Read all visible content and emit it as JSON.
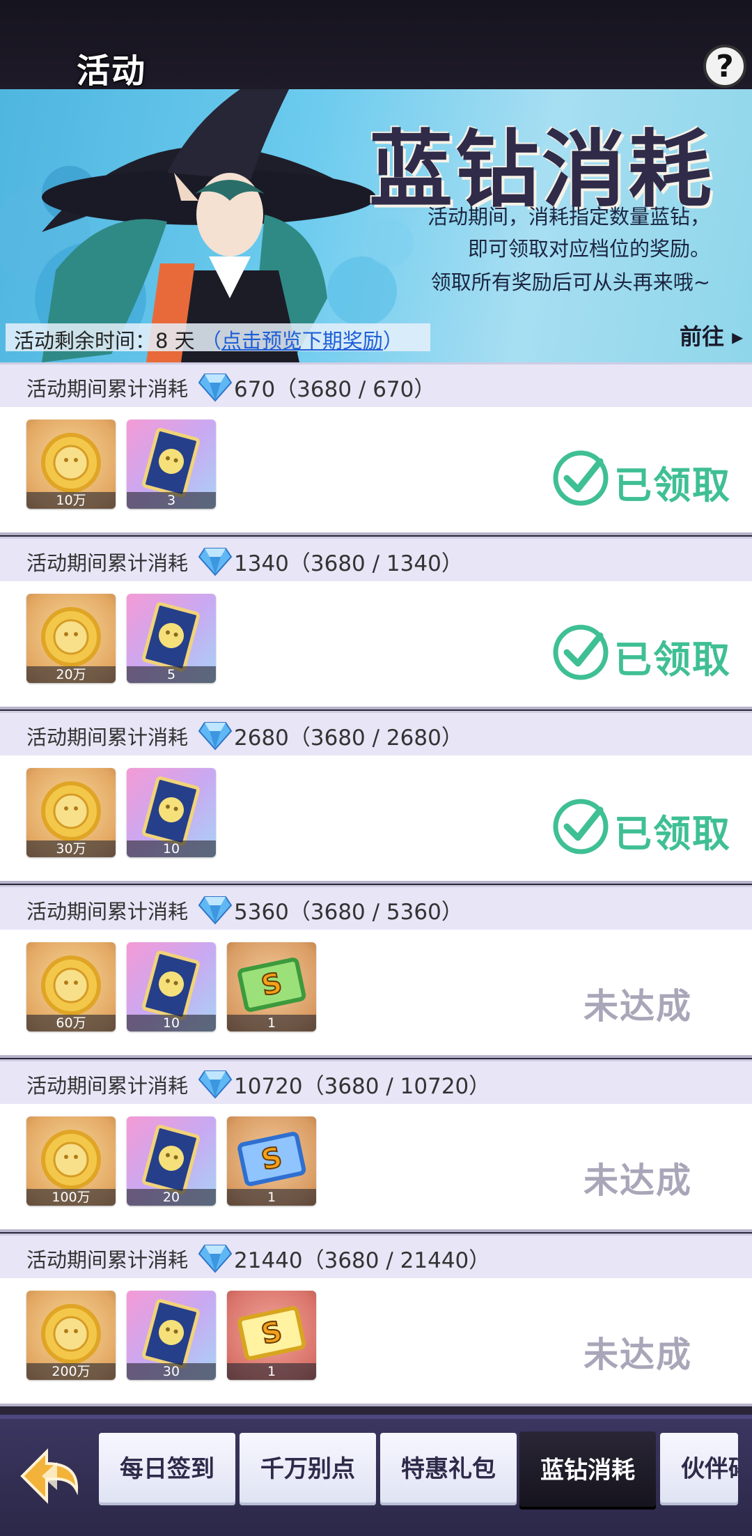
{
  "header": {
    "title": "活动",
    "help_icon": "question-mark-icon"
  },
  "banner": {
    "title": "蓝钻消耗",
    "desc_lines": [
      "活动期间，消耗指定数量蓝钻，",
      "即可领取对应档位的奖励。",
      "领取所有奖励后可从头再来哦~"
    ],
    "timer_label": "活动剩余时间：8 天",
    "timer_paren_open": "（",
    "preview_link": "点击预览下期奖励",
    "timer_paren_close": "）",
    "goto_label": "前往 ▸"
  },
  "tiers": [
    {
      "label": "活动期间累计消耗",
      "value": "670（3680 / 670）",
      "status": "已领取",
      "claimed": true,
      "rewards": [
        {
          "icon": "gold-coin-icon",
          "count": "10万"
        },
        {
          "icon": "card-pack-icon",
          "count": "3"
        }
      ]
    },
    {
      "label": "活动期间累计消耗",
      "value": "1340（3680 / 1340）",
      "status": "已领取",
      "claimed": true,
      "rewards": [
        {
          "icon": "gold-coin-icon",
          "count": "20万"
        },
        {
          "icon": "card-pack-icon",
          "count": "5"
        }
      ]
    },
    {
      "label": "活动期间累计消耗",
      "value": "2680（3680 / 2680）",
      "status": "已领取",
      "claimed": true,
      "rewards": [
        {
          "icon": "gold-coin-icon",
          "count": "30万"
        },
        {
          "icon": "card-pack-icon",
          "count": "10"
        }
      ]
    },
    {
      "label": "活动期间累计消耗",
      "value": "5360（3680 / 5360）",
      "status": "未达成",
      "claimed": false,
      "rewards": [
        {
          "icon": "gold-coin-icon",
          "count": "60万"
        },
        {
          "icon": "card-pack-icon",
          "count": "10"
        },
        {
          "icon": "s-ticket-green-icon",
          "count": "1"
        }
      ]
    },
    {
      "label": "活动期间累计消耗",
      "value": "10720（3680 / 10720）",
      "status": "未达成",
      "claimed": false,
      "rewards": [
        {
          "icon": "gold-coin-icon",
          "count": "100万"
        },
        {
          "icon": "card-pack-icon",
          "count": "20"
        },
        {
          "icon": "s-ticket-blue-icon",
          "count": "1"
        }
      ]
    },
    {
      "label": "活动期间累计消耗",
      "value": "21440（3680 / 21440）",
      "status": "未达成",
      "claimed": false,
      "rewards": [
        {
          "icon": "gold-coin-icon",
          "count": "200万"
        },
        {
          "icon": "card-pack-icon",
          "count": "30"
        },
        {
          "icon": "s-ticket-gold-icon",
          "count": "1"
        }
      ]
    }
  ],
  "tabs": [
    {
      "label": "每日签到",
      "active": false
    },
    {
      "label": "千万别点",
      "active": false
    },
    {
      "label": "特惠礼包",
      "active": false
    },
    {
      "label": "蓝钻消耗",
      "active": true
    },
    {
      "label": "伙伴碎",
      "active": false
    }
  ],
  "colors": {
    "claimed": "#3fbf94",
    "pending": "#a8a6b8",
    "link": "#1e5fd6",
    "tab_active_bg": "#15131d"
  }
}
